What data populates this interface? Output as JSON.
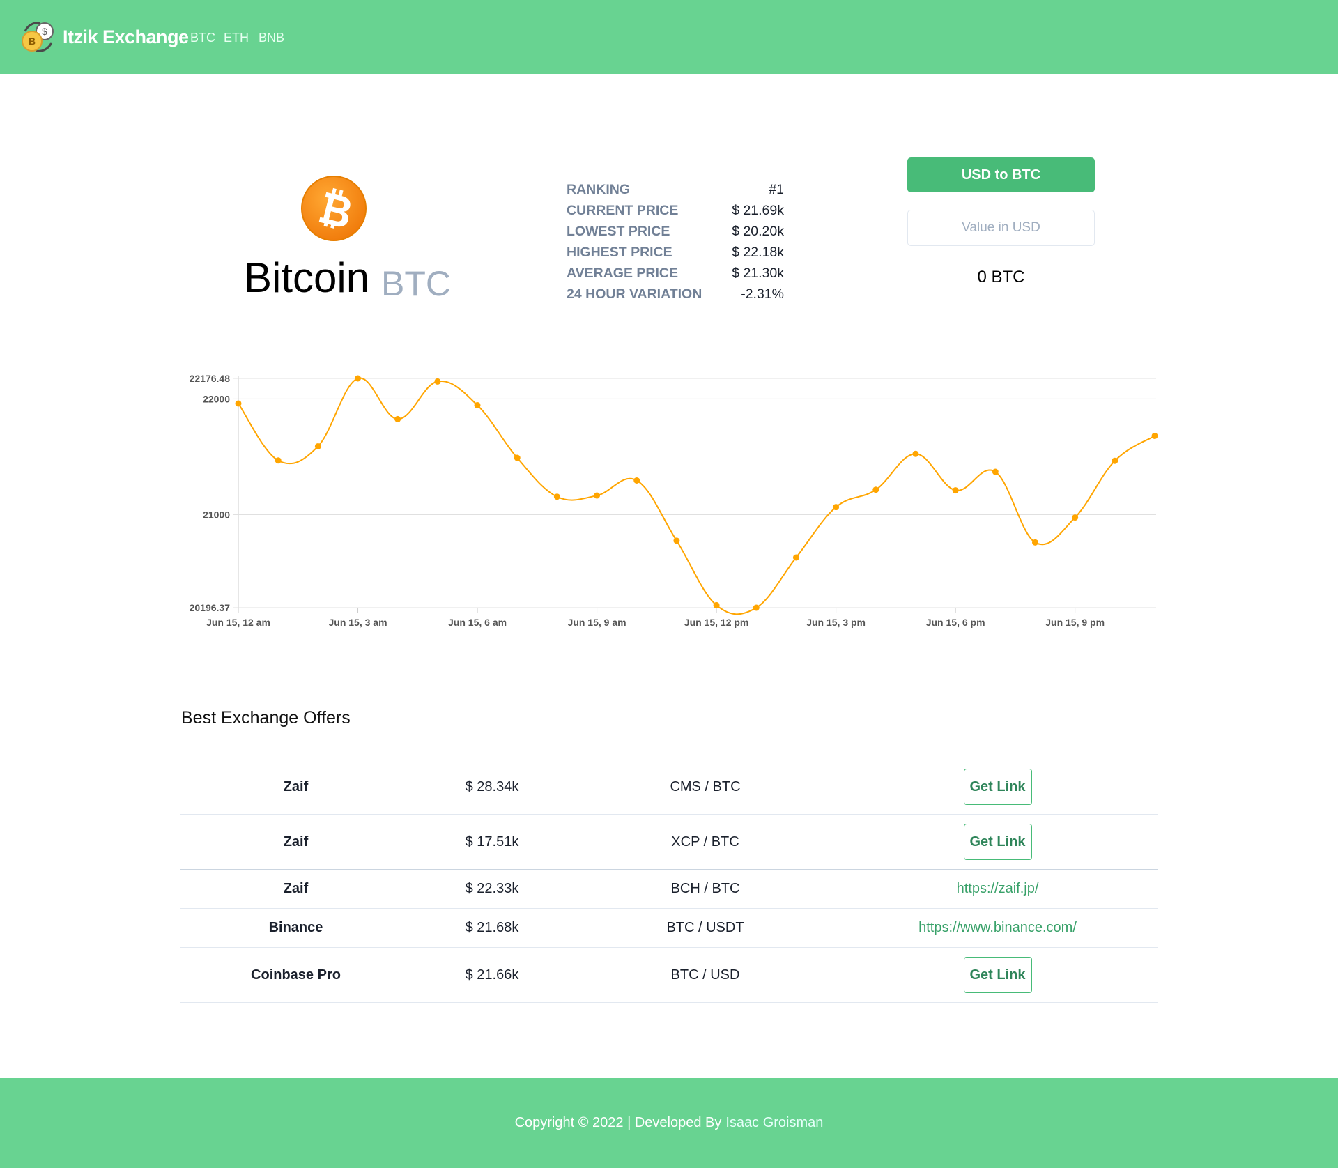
{
  "navbar": {
    "brand": "Itzik Exchange",
    "links": [
      "BTC",
      "ETH",
      "BNB"
    ],
    "colors": {
      "background": "#68d391"
    }
  },
  "coin": {
    "name": "Bitcoin",
    "symbol": "BTC",
    "icon": "bitcoin-icon",
    "icon_color": "#f7931a"
  },
  "stats": [
    {
      "label": "RANKING",
      "value": "#1"
    },
    {
      "label": "CURRENT PRICE",
      "value": "$ 21.69k"
    },
    {
      "label": "LOWEST PRICE",
      "value": "$ 20.20k"
    },
    {
      "label": "HIGHEST PRICE",
      "value": "$ 22.18k"
    },
    {
      "label": "AVERAGE PRICE",
      "value": "$ 21.30k"
    },
    {
      "label": "24 HOUR VARIATION",
      "value": "-2.31%"
    }
  ],
  "converter": {
    "button_label": "USD to BTC",
    "input_placeholder": "Value in USD",
    "input_value": "",
    "result": "0 BTC"
  },
  "chart_data": {
    "type": "line",
    "title": "",
    "xlabel": "",
    "ylabel": "",
    "x": [
      "Jun 15, 12 am",
      "",
      "",
      "Jun 15, 3 am",
      "",
      "",
      "Jun 15, 6 am",
      "",
      "",
      "Jun 15, 9 am",
      "",
      "",
      "Jun 15, 12 pm",
      "",
      "",
      "Jun 15, 3 pm",
      "",
      "",
      "Jun 15, 6 pm",
      "",
      "",
      "Jun 15, 9 pm",
      "",
      ""
    ],
    "x_tick_labels": [
      "Jun 15, 12 am",
      "Jun 15, 3 am",
      "Jun 15, 6 am",
      "Jun 15, 9 am",
      "Jun 15, 12 pm",
      "Jun 15, 3 pm",
      "Jun 15, 6 pm",
      "Jun 15, 9 pm"
    ],
    "y_tick_labels": [
      "22176.48",
      "22000",
      "21000",
      "20196.37"
    ],
    "y_ticks": [
      22176.48,
      22000,
      21000,
      20196.37
    ],
    "ylim": [
      20196.37,
      22176.48
    ],
    "series": [
      {
        "values": [
          21960,
          21468,
          21590,
          22176.48,
          21825,
          22150,
          21945,
          21490,
          21155,
          21165,
          21295,
          20775,
          20218,
          20196.37,
          20630,
          21065,
          21215,
          21525,
          21210,
          21370,
          20760,
          20975,
          21465,
          21680
        ],
        "color": "#ffa500"
      }
    ],
    "grid": true,
    "legend": "none"
  },
  "offers": {
    "title": "Best Exchange Offers",
    "rows": [
      {
        "exchange": "Zaif",
        "price": "$ 28.34k",
        "pair": "CMS / BTC",
        "link_type": "button",
        "link_label": "Get Link"
      },
      {
        "exchange": "Zaif",
        "price": "$ 17.51k",
        "pair": "XCP / BTC",
        "link_type": "button",
        "link_label": "Get Link"
      },
      {
        "exchange": "Zaif",
        "price": "$ 22.33k",
        "pair": "BCH / BTC",
        "link_type": "url",
        "link_label": "https://zaif.jp/"
      },
      {
        "exchange": "Binance",
        "price": "$ 21.68k",
        "pair": "BTC / USDT",
        "link_type": "url",
        "link_label": "https://www.binance.com/"
      },
      {
        "exchange": "Coinbase Pro",
        "price": "$ 21.66k",
        "pair": "BTC / USD",
        "link_type": "button",
        "link_label": "Get Link"
      }
    ]
  },
  "footer": {
    "text": "Copyright © 2022 | Developed By",
    "author": "Isaac Groisman"
  }
}
